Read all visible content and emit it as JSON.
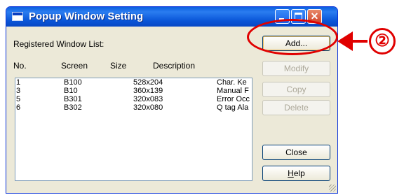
{
  "window": {
    "title": "Popup Window Setting"
  },
  "list_label": "Registered Window List:",
  "columns": [
    "No.",
    "Screen",
    "Size",
    "Description"
  ],
  "rows": [
    {
      "no": "1",
      "screen": "B100",
      "size": "528x204",
      "description": "Char. Ke"
    },
    {
      "no": "3",
      "screen": "B10",
      "size": "360x139",
      "description": "Manual F"
    },
    {
      "no": "5",
      "screen": "B301",
      "size": "320x083",
      "description": "Error Occ"
    },
    {
      "no": "6",
      "screen": "B302",
      "size": "320x080",
      "description": "Q tag Ala"
    }
  ],
  "buttons": {
    "add": "Add...",
    "modify": "Modify",
    "copy": "Copy",
    "delete": "Delete",
    "close": "Close",
    "help": "Help"
  },
  "callout": {
    "number": "②",
    "color": "#e00000"
  }
}
